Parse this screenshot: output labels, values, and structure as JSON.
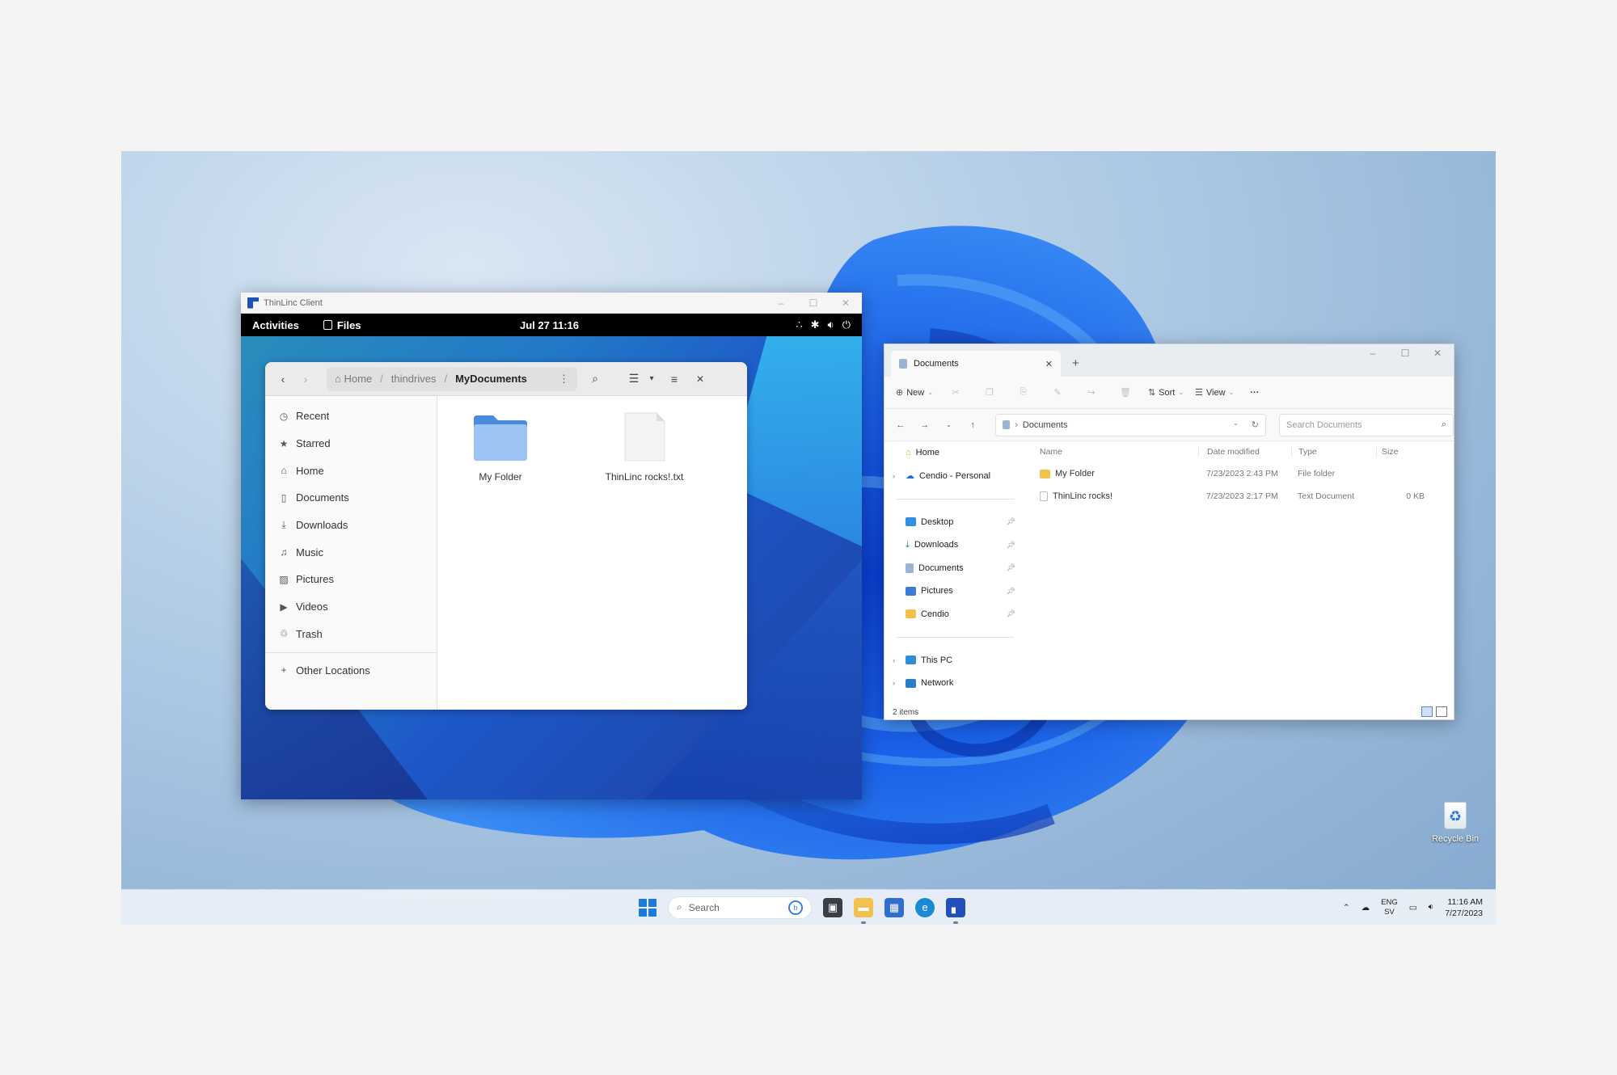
{
  "thinlinc": {
    "title": "ThinLinc Client",
    "controls": [
      "–",
      "☐",
      "✕"
    ]
  },
  "gnome_bar": {
    "activities": "Activities",
    "app": "Files",
    "clock": "Jul 27  11:16"
  },
  "nautilus": {
    "path": {
      "home": "Home",
      "parent": "thindrives",
      "current": "MyDocuments"
    },
    "sidebar": [
      {
        "label": "Recent",
        "icon": "clock-icon"
      },
      {
        "label": "Starred",
        "icon": "star-icon"
      },
      {
        "label": "Home",
        "icon": "home-icon"
      },
      {
        "label": "Documents",
        "icon": "document-icon"
      },
      {
        "label": "Downloads",
        "icon": "download-icon"
      },
      {
        "label": "Music",
        "icon": "music-icon"
      },
      {
        "label": "Pictures",
        "icon": "picture-icon"
      },
      {
        "label": "Videos",
        "icon": "video-icon"
      },
      {
        "label": "Trash",
        "icon": "trash-icon"
      }
    ],
    "other_locations": "Other Locations",
    "items": [
      {
        "name": "My Folder",
        "kind": "folder"
      },
      {
        "name": "ThinLinc rocks!.txt",
        "kind": "file"
      }
    ]
  },
  "explorer": {
    "tab_title": "Documents",
    "commands": {
      "new": "New",
      "sort": "Sort",
      "view": "View",
      "more": "···"
    },
    "address": "Documents",
    "search_placeholder": "Search Documents",
    "nav": [
      {
        "label": "Home",
        "icon": "home-icon",
        "chevron": false,
        "pinned": false
      },
      {
        "label": "Cendio - Personal",
        "icon": "onedrive-icon",
        "chevron": true,
        "pinned": false
      }
    ],
    "quick_access": [
      {
        "label": "Desktop",
        "icon": "desktop-icon"
      },
      {
        "label": "Downloads",
        "icon": "download-icon"
      },
      {
        "label": "Documents",
        "icon": "document-icon"
      },
      {
        "label": "Pictures",
        "icon": "picture-icon"
      },
      {
        "label": "Cendio",
        "icon": "folder-icon"
      }
    ],
    "locations": [
      {
        "label": "This PC",
        "icon": "pc-icon"
      },
      {
        "label": "Network",
        "icon": "network-icon"
      }
    ],
    "columns": {
      "name": "Name",
      "date": "Date modified",
      "type": "Type",
      "size": "Size"
    },
    "rows": [
      {
        "name": "My Folder",
        "date": "7/23/2023 2:43 PM",
        "type": "File folder",
        "size": ""
      },
      {
        "name": "ThinLinc rocks!",
        "date": "7/23/2023 2:17 PM",
        "type": "Text Document",
        "size": "0 KB"
      }
    ],
    "status": "2 items",
    "colors": {
      "folder": "#f2c14e",
      "accent": "#1f79d6"
    }
  },
  "recycle_bin": {
    "label": "Recycle Bin"
  },
  "taskbar": {
    "search": "Search",
    "tray": {
      "lang_top": "ENG",
      "lang_bottom": "SV",
      "time": "11:16 AM",
      "date": "7/27/2023"
    }
  }
}
